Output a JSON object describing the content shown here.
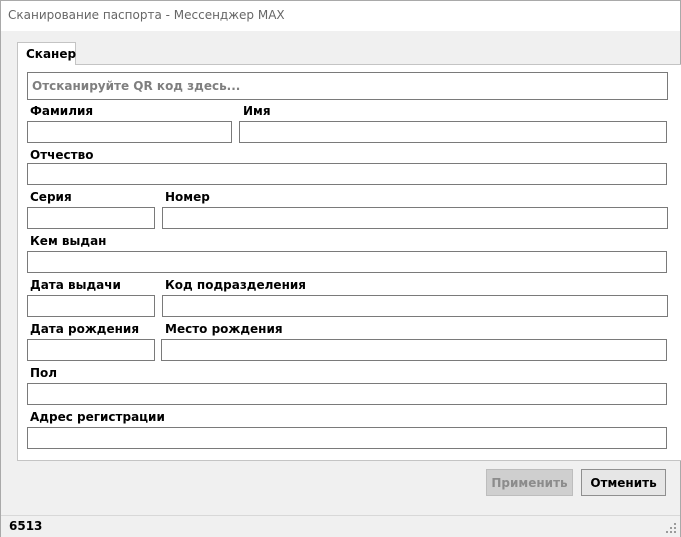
{
  "window": {
    "title": "Сканирование паспорта - Мессенджер MAX"
  },
  "tabs": [
    {
      "label": "Сканер"
    }
  ],
  "scanner": {
    "qr_placeholder": "Отсканируйте QR код здесь...",
    "labels": {
      "surname": "Фамилия",
      "name": "Имя",
      "patronymic": "Отчество",
      "series": "Серия",
      "number": "Номер",
      "issued_by": "Кем выдан",
      "issue_date": "Дата выдачи",
      "division_code": "Код подразделения",
      "birth_date": "Дата рождения",
      "birth_place": "Место рождения",
      "gender": "Пол",
      "registration_address": "Адрес регистрации"
    },
    "values": {
      "surname": "",
      "name": "",
      "patronymic": "",
      "series": "",
      "number": "",
      "issued_by": "",
      "issue_date": "",
      "division_code": "",
      "birth_date": "",
      "birth_place": "",
      "gender": "",
      "registration_address": ""
    }
  },
  "buttons": {
    "apply": "Применить",
    "cancel": "Отменить"
  },
  "status": {
    "number": "6513"
  }
}
